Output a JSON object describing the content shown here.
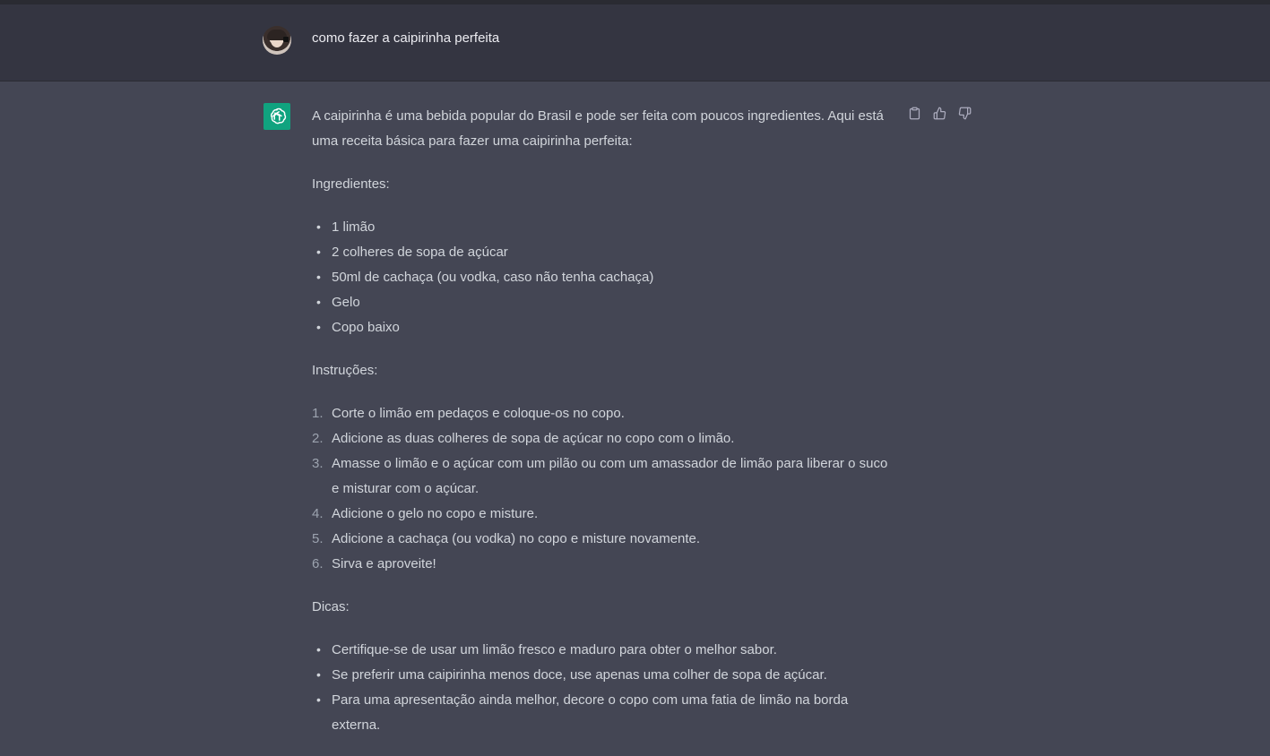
{
  "user": {
    "prompt": "como fazer a caipirinha perfeita"
  },
  "assistant": {
    "intro": "A caipirinha é uma bebida popular do Brasil e pode ser feita com poucos ingredientes. Aqui está uma receita básica para fazer uma caipirinha perfeita:",
    "ingredients_heading": "Ingredientes:",
    "ingredients": [
      "1 limão",
      "2 colheres de sopa de açúcar",
      "50ml de cachaça (ou vodka, caso não tenha cachaça)",
      "Gelo",
      "Copo baixo"
    ],
    "instructions_heading": "Instruções:",
    "instructions": [
      {
        "num": "1.",
        "text": "Corte o limão em pedaços e coloque-os no copo."
      },
      {
        "num": "2.",
        "text": "Adicione as duas colheres de sopa de açúcar no copo com o limão."
      },
      {
        "num": "3.",
        "text": "Amasse o limão e o açúcar com um pilão ou com um amassador de limão para liberar o suco e misturar com o açúcar."
      },
      {
        "num": "4.",
        "text": "Adicione o gelo no copo e misture."
      },
      {
        "num": "5.",
        "text": "Adicione a cachaça (ou vodka) no copo e misture novamente."
      },
      {
        "num": "6.",
        "text": "Sirva e aproveite!"
      }
    ],
    "tips_heading": "Dicas:",
    "tips": [
      "Certifique-se de usar um limão fresco e maduro para obter o melhor sabor.",
      "Se preferir uma caipirinha menos doce, use apenas uma colher de sopa de açúcar.",
      "Para uma apresentação ainda melhor, decore o copo com uma fatia de limão na borda externa."
    ],
    "bullet_glyph": "•"
  },
  "icons": {
    "avatar": "user-avatar",
    "assistant": "openai-logo-icon",
    "copy": "clipboard-icon",
    "like": "thumbs-up-icon",
    "dislike": "thumbs-down-icon"
  },
  "colors": {
    "user_bg": "#343541",
    "assistant_bg": "#444654",
    "assistant_icon_bg": "#10a37f"
  }
}
